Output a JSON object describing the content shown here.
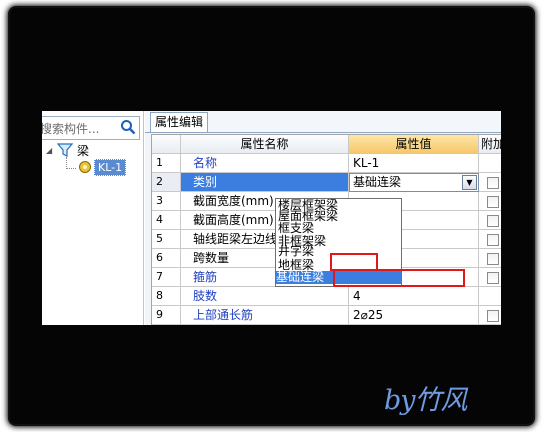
{
  "search": {
    "placeholder": "搜索构件..."
  },
  "tree": {
    "root": "梁",
    "child": "KL-1"
  },
  "tab": {
    "label": "属性编辑"
  },
  "table": {
    "headers": {
      "name": "属性名称",
      "value": "属性值",
      "add": "附加"
    },
    "rows": [
      {
        "num": "1",
        "name": "名称",
        "value": "KL-1"
      },
      {
        "num": "2",
        "name": "类别",
        "value": "基础连梁"
      },
      {
        "num": "3",
        "name": "截面宽度(mm)",
        "value": ""
      },
      {
        "num": "4",
        "name": "截面高度(mm)",
        "value": ""
      },
      {
        "num": "5",
        "name": "轴线距梁左边线距离(mm)",
        "value": ""
      },
      {
        "num": "6",
        "name": "跨数量",
        "value": ""
      },
      {
        "num": "7",
        "name": "箍筋",
        "value": ""
      },
      {
        "num": "8",
        "name": "肢数",
        "value": "4"
      },
      {
        "num": "9",
        "name": "上部通长筋",
        "value": "2⌀25"
      }
    ]
  },
  "dropdown": {
    "options": [
      "楼层框架梁",
      "屋面框架梁",
      "框支梁",
      "非框架梁",
      "井字梁",
      "地框梁",
      "基础连梁"
    ],
    "selected": "基础连梁"
  },
  "watermark": "by竹风"
}
